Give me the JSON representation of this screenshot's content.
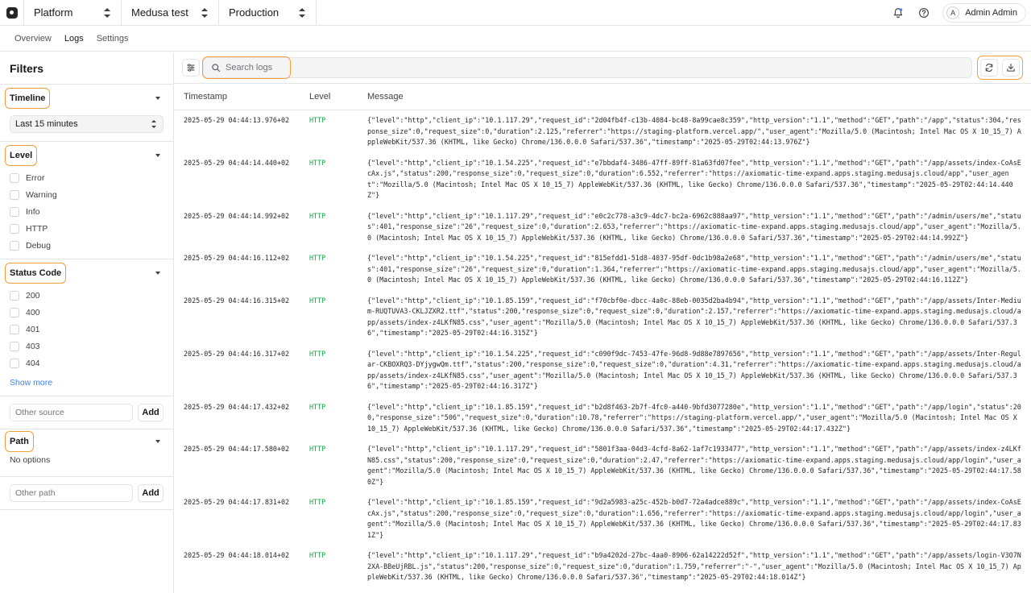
{
  "topbar": {
    "org": "Platform",
    "project": "Medusa test",
    "environment": "Production",
    "user_initial": "A",
    "user_name": "Admin Admin"
  },
  "nav": {
    "tabs": [
      "Overview",
      "Logs",
      "Settings"
    ],
    "active": "Logs"
  },
  "filters": {
    "title": "Filters",
    "timeline": {
      "title": "Timeline",
      "selected": "Last 15 minutes"
    },
    "level": {
      "title": "Level",
      "options": [
        "Error",
        "Warning",
        "Info",
        "HTTP",
        "Debug"
      ]
    },
    "status_code": {
      "title": "Status Code",
      "options": [
        "200",
        "400",
        "401",
        "403",
        "404"
      ],
      "show_more": "Show more"
    },
    "source": {
      "placeholder": "Other source",
      "add_label": "Add"
    },
    "path": {
      "title": "Path",
      "empty": "No options",
      "placeholder": "Other path",
      "add_label": "Add"
    }
  },
  "search": {
    "placeholder": "Search logs"
  },
  "table": {
    "headers": {
      "timestamp": "Timestamp",
      "level": "Level",
      "message": "Message"
    },
    "rows": [
      {
        "ts": "2025-05-29 04:44:13.976+02",
        "level": "HTTP",
        "msg": "{\"level\":\"http\",\"client_ip\":\"10.1.117.29\",\"request_id\":\"2d04fb4f-c13b-4084-bc48-8a99cae8c359\",\"http_version\":\"1.1\",\"method\":\"GET\",\"path\":\"/app\",\"status\":304,\"response_size\":0,\"request_size\":0,\"duration\":2.125,\"referrer\":\"https://staging-platform.vercel.app/\",\"user_agent\":\"Mozilla/5.0 (Macintosh; Intel Mac OS X 10_15_7) AppleWebKit/537.36 (KHTML, like Gecko) Chrome/136.0.0.0 Safari/537.36\",\"timestamp\":\"2025-05-29T02:44:13.976Z\"}"
      },
      {
        "ts": "2025-05-29 04:44:14.440+02",
        "level": "HTTP",
        "msg": "{\"level\":\"http\",\"client_ip\":\"10.1.54.225\",\"request_id\":\"e7bbdaf4-3486-47ff-89ff-81a63fd07fee\",\"http_version\":\"1.1\",\"method\":\"GET\",\"path\":\"/app/assets/index-CoAsEcAx.js\",\"status\":200,\"response_size\":0,\"request_size\":0,\"duration\":6.552,\"referrer\":\"https://axiomatic-time-expand.apps.staging.medusajs.cloud/app\",\"user_agent\":\"Mozilla/5.0 (Macintosh; Intel Mac OS X 10_15_7) AppleWebKit/537.36 (KHTML, like Gecko) Chrome/136.0.0.0 Safari/537.36\",\"timestamp\":\"2025-05-29T02:44:14.440Z\"}"
      },
      {
        "ts": "2025-05-29 04:44:14.992+02",
        "level": "HTTP",
        "msg": "{\"level\":\"http\",\"client_ip\":\"10.1.117.29\",\"request_id\":\"e0c2c778-a3c9-4dc7-bc2a-6962c888aa97\",\"http_version\":\"1.1\",\"method\":\"GET\",\"path\":\"/admin/users/me\",\"status\":401,\"response_size\":\"26\",\"request_size\":0,\"duration\":2.653,\"referrer\":\"https://axiomatic-time-expand.apps.staging.medusajs.cloud/app\",\"user_agent\":\"Mozilla/5.0 (Macintosh; Intel Mac OS X 10_15_7) AppleWebKit/537.36 (KHTML, like Gecko) Chrome/136.0.0.0 Safari/537.36\",\"timestamp\":\"2025-05-29T02:44:14.992Z\"}"
      },
      {
        "ts": "2025-05-29 04:44:16.112+02",
        "level": "HTTP",
        "msg": "{\"level\":\"http\",\"client_ip\":\"10.1.54.225\",\"request_id\":\"815efdd1-51d8-4037-95df-0dc1b98a2e68\",\"http_version\":\"1.1\",\"method\":\"GET\",\"path\":\"/admin/users/me\",\"status\":401,\"response_size\":\"26\",\"request_size\":0,\"duration\":1.364,\"referrer\":\"https://axiomatic-time-expand.apps.staging.medusajs.cloud/app\",\"user_agent\":\"Mozilla/5.0 (Macintosh; Intel Mac OS X 10_15_7) AppleWebKit/537.36 (KHTML, like Gecko) Chrome/136.0.0.0 Safari/537.36\",\"timestamp\":\"2025-05-29T02:44:16.112Z\"}"
      },
      {
        "ts": "2025-05-29 04:44:16.315+02",
        "level": "HTTP",
        "msg": "{\"level\":\"http\",\"client_ip\":\"10.1.85.159\",\"request_id\":\"f70cbf0e-dbcc-4a0c-88eb-0035d2ba4b94\",\"http_version\":\"1.1\",\"method\":\"GET\",\"path\":\"/app/assets/Inter-Medium-RUQTUVA3-CKLJZXR2.ttf\",\"status\":200,\"response_size\":0,\"request_size\":0,\"duration\":2.157,\"referrer\":\"https://axiomatic-time-expand.apps.staging.medusajs.cloud/app/assets/index-z4LKfN85.css\",\"user_agent\":\"Mozilla/5.0 (Macintosh; Intel Mac OS X 10_15_7) AppleWebKit/537.36 (KHTML, like Gecko) Chrome/136.0.0.0 Safari/537.36\",\"timestamp\":\"2025-05-29T02:44:16.315Z\"}"
      },
      {
        "ts": "2025-05-29 04:44:16.317+02",
        "level": "HTTP",
        "msg": "{\"level\":\"http\",\"client_ip\":\"10.1.54.225\",\"request_id\":\"c090f9dc-7453-47fe-96d8-9d88e7897656\",\"http_version\":\"1.1\",\"method\":\"GET\",\"path\":\"/app/assets/Inter-Regular-CKBOXRQ3-DYjygwQm.ttf\",\"status\":200,\"response_size\":0,\"request_size\":0,\"duration\":4.31,\"referrer\":\"https://axiomatic-time-expand.apps.staging.medusajs.cloud/app/assets/index-z4LKfN85.css\",\"user_agent\":\"Mozilla/5.0 (Macintosh; Intel Mac OS X 10_15_7) AppleWebKit/537.36 (KHTML, like Gecko) Chrome/136.0.0.0 Safari/537.36\",\"timestamp\":\"2025-05-29T02:44:16.317Z\"}"
      },
      {
        "ts": "2025-05-29 04:44:17.432+02",
        "level": "HTTP",
        "msg": "{\"level\":\"http\",\"client_ip\":\"10.1.85.159\",\"request_id\":\"b2d8f463-2b7f-4fc0-a440-9bfd3077280e\",\"http_version\":\"1.1\",\"method\":\"GET\",\"path\":\"/app/login\",\"status\":200,\"response_size\":\"506\",\"request_size\":0,\"duration\":10.78,\"referrer\":\"https://staging-platform.vercel.app/\",\"user_agent\":\"Mozilla/5.0 (Macintosh; Intel Mac OS X 10_15_7) AppleWebKit/537.36 (KHTML, like Gecko) Chrome/136.0.0.0 Safari/537.36\",\"timestamp\":\"2025-05-29T02:44:17.432Z\"}"
      },
      {
        "ts": "2025-05-29 04:44:17.580+02",
        "level": "HTTP",
        "msg": "{\"level\":\"http\",\"client_ip\":\"10.1.117.29\",\"request_id\":\"5801f3aa-04d3-4cfd-8a62-1af7c1933477\",\"http_version\":\"1.1\",\"method\":\"GET\",\"path\":\"/app/assets/index-z4LKfN85.css\",\"status\":200,\"response_size\":0,\"request_size\":0,\"duration\":2.47,\"referrer\":\"https://axiomatic-time-expand.apps.staging.medusajs.cloud/app/login\",\"user_agent\":\"Mozilla/5.0 (Macintosh; Intel Mac OS X 10_15_7) AppleWebKit/537.36 (KHTML, like Gecko) Chrome/136.0.0.0 Safari/537.36\",\"timestamp\":\"2025-05-29T02:44:17.580Z\"}"
      },
      {
        "ts": "2025-05-29 04:44:17.831+02",
        "level": "HTTP",
        "msg": "{\"level\":\"http\",\"client_ip\":\"10.1.85.159\",\"request_id\":\"9d2a5983-a25c-452b-b0d7-72a4adce889c\",\"http_version\":\"1.1\",\"method\":\"GET\",\"path\":\"/app/assets/index-CoAsEcAx.js\",\"status\":200,\"response_size\":0,\"request_size\":0,\"duration\":1.656,\"referrer\":\"https://axiomatic-time-expand.apps.staging.medusajs.cloud/app/login\",\"user_agent\":\"Mozilla/5.0 (Macintosh; Intel Mac OS X 10_15_7) AppleWebKit/537.36 (KHTML, like Gecko) Chrome/136.0.0.0 Safari/537.36\",\"timestamp\":\"2025-05-29T02:44:17.831Z\"}"
      },
      {
        "ts": "2025-05-29 04:44:18.014+02",
        "level": "HTTP",
        "msg": "{\"level\":\"http\",\"client_ip\":\"10.1.117.29\",\"request_id\":\"b9a4202d-27bc-4aa0-8906-62a14222d52f\",\"http_version\":\"1.1\",\"method\":\"GET\",\"path\":\"/app/assets/login-V3O7N2XA-BBeUjRBL.js\",\"status\":200,\"response_size\":0,\"request_size\":0,\"duration\":1.759,\"referrer\":\"-\",\"user_agent\":\"Mozilla/5.0 (Macintosh; Intel Mac OS X 10_15_7) AppleWebKit/537.36 (KHTML, like Gecko) Chrome/136.0.0.0 Safari/537.36\",\"timestamp\":\"2025-05-29T02:44:18.014Z\"}"
      }
    ]
  },
  "colors": {
    "highlight": "#f59e3b",
    "http_level": "#16a34a",
    "link": "#3b82f6"
  }
}
